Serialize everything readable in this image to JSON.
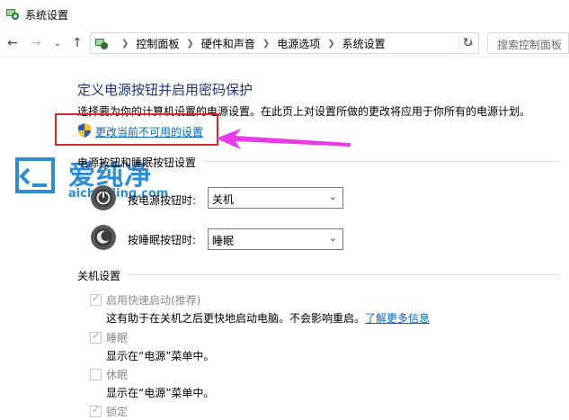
{
  "window": {
    "title": "系统设置",
    "icon": "power-options-icon"
  },
  "nav": {
    "back_icon": "back-arrow-icon",
    "forward_icon": "forward-arrow-icon",
    "recent_icon": "chevron-down-icon",
    "up_icon": "up-arrow-icon",
    "breadcrumb": [
      "控制面板",
      "硬件和声音",
      "电源选项",
      "系统设置"
    ],
    "refresh_icon": "refresh-icon",
    "search_placeholder": "搜索控制面板"
  },
  "main": {
    "heading": "定义电源按钮并启用密码保护",
    "description": "选择要为你的计算机设置的电源设置。在此页上对设置所做的更改将应用于你所有的电源计划。",
    "change_link": "更改当前不可用的设置",
    "highlight_color": "#e0262d",
    "arrow_color": "#e83de6"
  },
  "watermark": {
    "brand": "爱纯净",
    "url": "aichunjing.com"
  },
  "power_buttons": {
    "section_title": "电源按钮和睡眠按钮设置",
    "power_label": "按电源按钮时:",
    "power_value": "关机",
    "sleep_label": "按睡眠按钮时:",
    "sleep_value": "睡眠"
  },
  "shutdown": {
    "section_title": "关机设置",
    "items": [
      {
        "label": "启用快速启动(推荐)",
        "checked": true,
        "desc": "这有助于在关机之后更快地启动电脑。不会影响重启。",
        "link": "了解更多信息"
      },
      {
        "label": "睡眠",
        "checked": true,
        "desc": "显示在“电源”菜单中。"
      },
      {
        "label": "休眠",
        "checked": false,
        "desc": "显示在“电源”菜单中。"
      },
      {
        "label": "锁定",
        "checked": true
      }
    ]
  }
}
